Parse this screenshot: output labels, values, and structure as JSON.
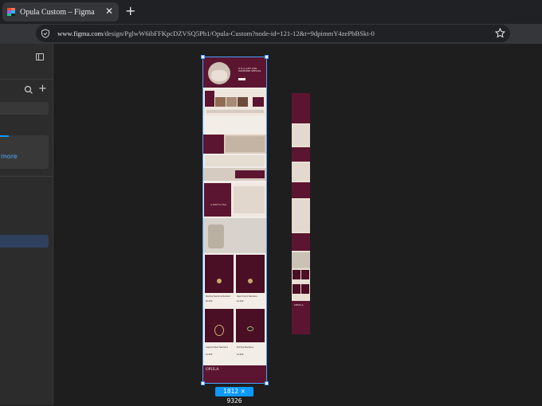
{
  "browser": {
    "tab_title": "Opula  Custom  – Figma",
    "tab_close": "✕",
    "new_tab": "+",
    "url_host": "www.figma.com",
    "url_path": "/design/PglwW6ibFFKpcDZVSQ5Ph1/Opula-Custom?node-id=121-12&t=9dpimmY4zePbBSkt-0"
  },
  "sidebar": {
    "more_link": "more",
    "add_label": "+"
  },
  "canvas": {
    "selection_size": "1812 × 9326",
    "design": {
      "hero_heading": "IT'S A GIFT FOR SOMEONE SPECIAL",
      "brand": "OPULA",
      "feature_text": "A Gift For Her",
      "product_1_name": "Sterling Teardrop Pendant",
      "product_1_price": "$2,499",
      "product_2_name": "Opal Charm Necklace",
      "product_2_price": "$1,499",
      "product_3_name": "Layered Pearl Necklace",
      "product_3_price": "$1,999",
      "product_4_name": "Evil Eye Necklace",
      "product_4_price": "$1,999"
    }
  },
  "colors": {
    "accent": "#0d99ff",
    "maroon": "#5c1530",
    "cream": "#f3ede8"
  }
}
